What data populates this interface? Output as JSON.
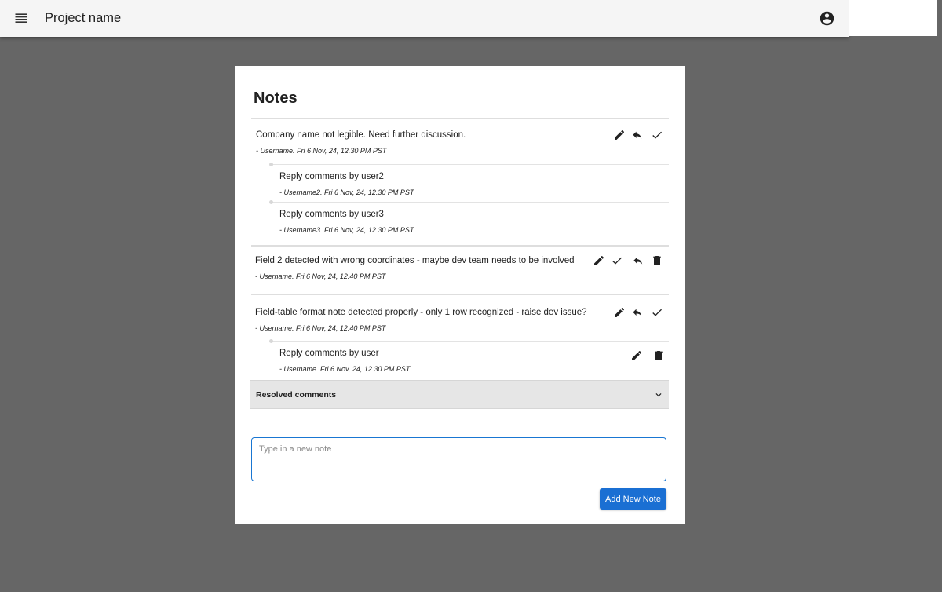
{
  "app_bar": {
    "title": "Project name",
    "menu_icon": "menu-icon",
    "account_icon": "account-circle-icon"
  },
  "panel": {
    "title": "Notes",
    "notes": [
      {
        "text": "Company name not legible. Need further discussion.",
        "meta": "- Username. Fri 6 Nov, 24, 12.30 PM PST",
        "actions": [
          "edit",
          "reply",
          "resolve"
        ],
        "replies": [
          {
            "text": "Reply comments by user2",
            "meta": "- Username2. Fri 6 Nov, 24, 12.30 PM PST"
          },
          {
            "text": "Reply comments by user3",
            "meta": "- Username3. Fri 6 Nov, 24, 12.30 PM PST"
          }
        ]
      },
      {
        "text": "Field 2 detected with wrong coordinates - maybe dev team needs to be involved",
        "meta": "- Username. Fri 6 Nov, 24, 12.40 PM PST",
        "actions": [
          "edit",
          "resolve",
          "reply",
          "delete"
        ],
        "replies": []
      },
      {
        "text": "Field-table format note detected properly - only 1 row recognized - raise dev issue?",
        "meta": "- Username. Fri 6 Nov, 24, 12.40 PM PST",
        "actions": [
          "edit",
          "reply",
          "resolve"
        ],
        "replies": [
          {
            "text": "Reply comments by user",
            "meta": "- Username. Fri 6 Nov, 24, 12.30 PM PST",
            "actions": [
              "edit",
              "delete"
            ]
          }
        ]
      }
    ],
    "resolved_label": "Resolved comments",
    "input_placeholder": "Type in a new note",
    "input_value": "",
    "add_button_label": "Add New Note"
  },
  "colors": {
    "backdrop": "#666666",
    "primary": "#1a6fd3",
    "input_border": "#1976d2",
    "resolved_bg": "#e6e6e6"
  }
}
